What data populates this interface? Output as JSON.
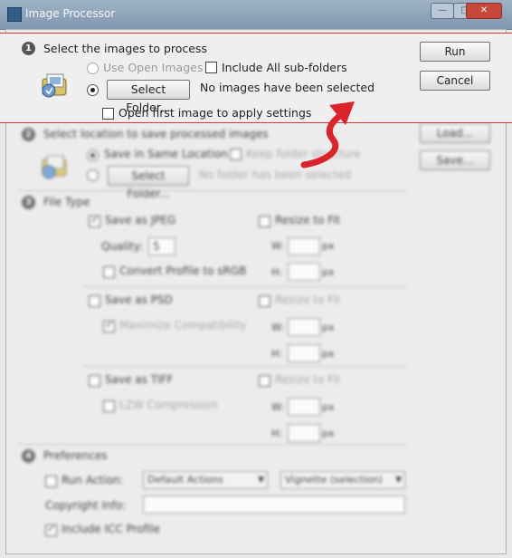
{
  "window": {
    "title": "Image Processor"
  },
  "step1": {
    "number": "1",
    "title": "Select the images to process",
    "use_open_images": "Use Open Images",
    "include_subfolders": "Include All sub-folders",
    "select_folder": "Select Folder...",
    "status": "No images have been selected",
    "open_first": "Open first image to apply settings"
  },
  "buttons": {
    "run": "Run",
    "cancel": "Cancel",
    "load": "Load...",
    "save": "Save..."
  },
  "step2": {
    "number": "2",
    "title": "Select location to save processed images",
    "save_same": "Save in Same Location",
    "keep_structure": "Keep folder structure",
    "select_folder": "Select Folder...",
    "status": "No folder has been selected"
  },
  "step3": {
    "number": "3",
    "title": "File Type",
    "save_jpeg": "Save as JPEG",
    "resize_fit": "Resize to Fit",
    "quality_label": "Quality:",
    "quality_value": "5",
    "convert_srgb": "Convert Profile to sRGB",
    "save_psd": "Save as PSD",
    "maximize_compat": "Maximize Compatibility",
    "save_tiff": "Save as TIFF",
    "lzw": "LZW Compression",
    "w_label": "W:",
    "h_label": "H:",
    "px": "px"
  },
  "step4": {
    "number": "4",
    "title": "Preferences",
    "run_action": "Run Action:",
    "action_set": "Default Actions",
    "action": "Vignette (selection)",
    "copyright": "Copyright Info:",
    "include_icc": "Include ICC Profile"
  },
  "colors": {
    "highlight_border": "#d23a3a",
    "arrow": "#d8242a"
  },
  "icons": {
    "folder_icon": "folder-icon",
    "step_number": "step-number-icon"
  }
}
